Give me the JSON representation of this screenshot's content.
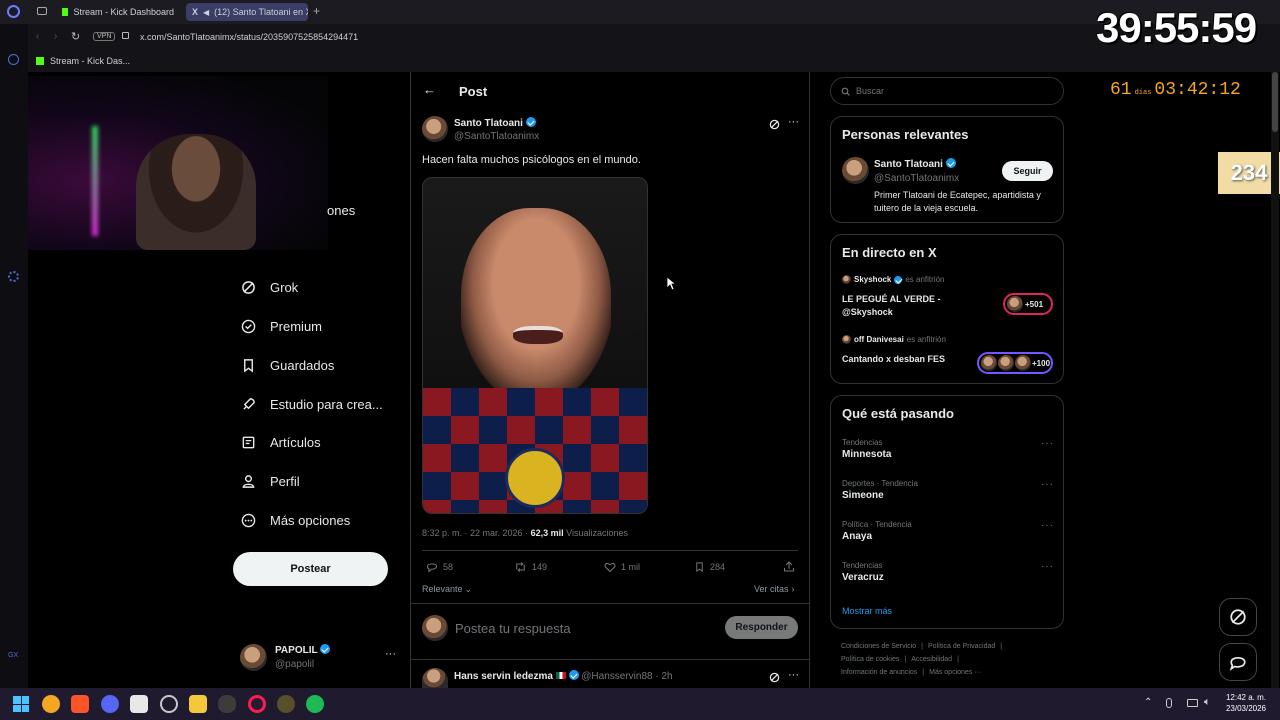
{
  "browser": {
    "tabs": [
      {
        "label": "Stream - Kick Dashboard"
      },
      {
        "label": "(12) Santo Tlatoani en X"
      }
    ],
    "url": "x.com/SantoTlatoanimx/status/2035907525854294471",
    "vpn_label": "VPN",
    "bookmark": "Stream - Kick Das..."
  },
  "overlay": {
    "stream_timer": "39:55:59",
    "countdown_days": "61",
    "countdown_days_label": "días",
    "countdown_time": "03:42:12",
    "counter": "234"
  },
  "sidebar": {
    "truncated_label": "ones",
    "items": [
      {
        "label": "Grok",
        "icon": "grok-icon"
      },
      {
        "label": "Premium",
        "icon": "premium-icon"
      },
      {
        "label": "Guardados",
        "icon": "bookmark-icon"
      },
      {
        "label": "Estudio para crea...",
        "icon": "rocket-icon"
      },
      {
        "label": "Artículos",
        "icon": "articles-icon"
      },
      {
        "label": "Perfil",
        "icon": "profile-icon"
      },
      {
        "label": "Más opciones",
        "icon": "more-circle-icon"
      }
    ],
    "post_button": "Postear",
    "account": {
      "name": "PAPOLIL",
      "handle": "@papolil"
    }
  },
  "post": {
    "header_title": "Post",
    "author_name": "Santo Tlatoani",
    "author_handle": "@SantoTlatoanimx",
    "text": "Hacen falta muchos psicólogos en el mundo.",
    "time": "8:32 p. m. · 22 mar. 2026 ·",
    "views_count": "62,3 mil",
    "views_label": "Visualizaciones",
    "stats": {
      "replies": "58",
      "reposts": "149",
      "likes": "1 mil",
      "bookmarks": "284"
    },
    "sort_label": "Relevante",
    "quotes_label": "Ver citas",
    "reply_placeholder": "Postea tu respuesta",
    "reply_button": "Responder"
  },
  "reply_preview": {
    "name": "Hans servin ledezma",
    "handle": "@Hansservin88 · 2h"
  },
  "right": {
    "search_placeholder": "Buscar",
    "relevant": {
      "title": "Personas relevantes",
      "name": "Santo Tlatoani",
      "handle": "@SantoTlatoanimx",
      "bio": "Primer Tlatoani de Ecatepec, apartidista y tuitero de la vieja escuela.",
      "follow_button": "Seguir"
    },
    "live": {
      "title": "En directo en X",
      "items": [
        {
          "host": "Skyshock",
          "host_label": "es anfitrión",
          "title": "LE PEGUÉ AL VERDE - @Skyshock",
          "count": "+501"
        },
        {
          "host": "off Danivesai",
          "host_label": "es anfitrión",
          "title": "Cantando x desban FES",
          "count": "+100"
        }
      ]
    },
    "trends": {
      "title": "Qué está pasando",
      "items": [
        {
          "category": "Tendencias",
          "name": "Minnesota"
        },
        {
          "category": "Deportes · Tendencia",
          "name": "Simeone"
        },
        {
          "category": "Política · Tendencia",
          "name": "Anaya"
        },
        {
          "category": "Tendencias",
          "name": "Veracruz"
        }
      ],
      "show_more": "Mostrar más"
    },
    "footer": [
      "Condiciones de Servicio",
      "Política de Privacidad",
      "Política de cookies",
      "Accesibilidad",
      "Información de anuncios",
      "Más opciones ···"
    ]
  },
  "taskbar": {
    "time": "12:42 a. m.",
    "date": "23/03/2026"
  },
  "left_rail_text": "GX"
}
